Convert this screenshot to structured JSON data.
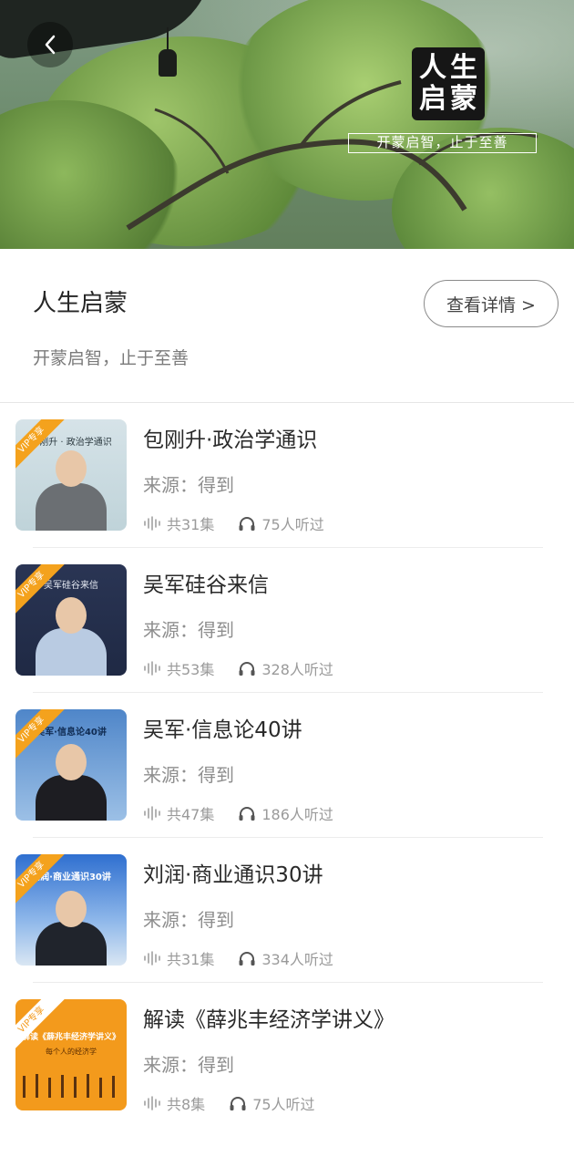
{
  "banner": {
    "logo_chars": [
      "人",
      "生",
      "启",
      "蒙"
    ],
    "slogan": "开蒙启智，止于至善"
  },
  "header": {
    "title": "人生启蒙",
    "details_button": "查看详情 >",
    "subtitle": "开蒙启智，止于至善"
  },
  "icons": {
    "back": "chevron-left-icon",
    "episodes": "audio-wave-icon",
    "listeners": "headphones-icon"
  },
  "colors": {
    "vip_ribbon": "#f4a21d",
    "title_text": "#2a2a2a",
    "secondary_text": "#8e8e8e"
  },
  "courses": [
    {
      "title": "包刚升·政治学通识",
      "source": "来源：得到",
      "episodes": "共31集",
      "listeners": "75人听过",
      "vip_badge": "VIP专享",
      "thumb_caption": "包刚升 · 政治学通识"
    },
    {
      "title": "吴军硅谷来信",
      "source": "来源：得到",
      "episodes": "共53集",
      "listeners": "328人听过",
      "vip_badge": "VIP专享",
      "thumb_caption": "吴军硅谷来信"
    },
    {
      "title": "吴军·信息论40讲",
      "source": "来源：得到",
      "episodes": "共47集",
      "listeners": "186人听过",
      "vip_badge": "VIP专享",
      "thumb_caption": "吴军·信息论40讲"
    },
    {
      "title": "刘润·商业通识30讲",
      "source": "来源：得到",
      "episodes": "共31集",
      "listeners": "334人听过",
      "vip_badge": "VIP专享",
      "thumb_caption": "刘润·商业通识30讲"
    },
    {
      "title": "解读《薛兆丰经济学讲义》",
      "source": "来源：得到",
      "episodes": "共8集",
      "listeners": "75人听过",
      "vip_badge": "VIP专享",
      "thumb_caption": "解读《薛兆丰经济学讲义》",
      "thumb_subcaption": "每个人的经济学"
    }
  ]
}
